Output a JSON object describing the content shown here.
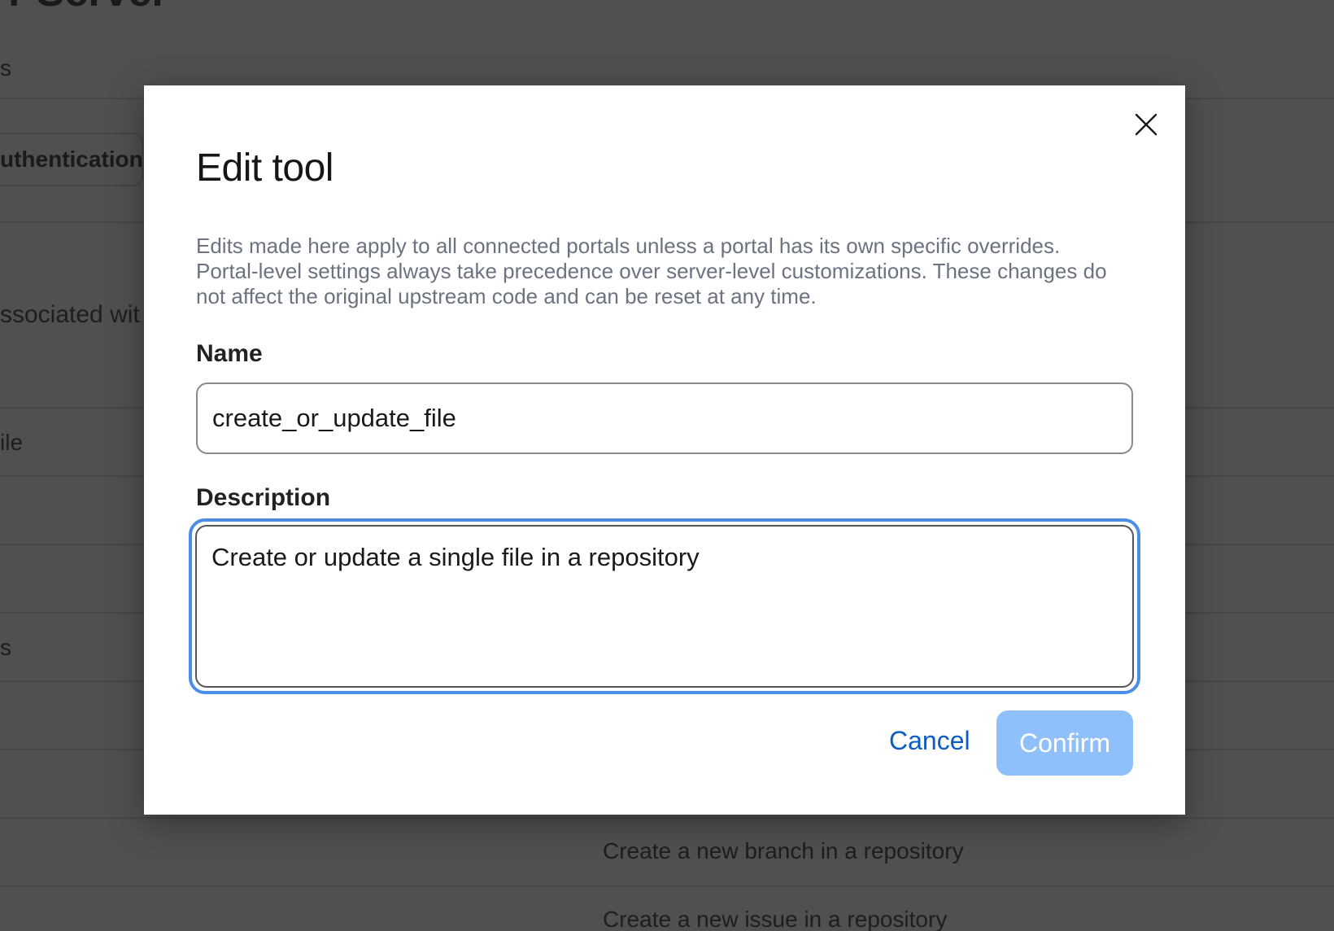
{
  "background": {
    "page_title_fragment": "r Server",
    "tab_fragment": "s",
    "auth_tab_label": "uthentication",
    "section_heading_fragment": "ssociated wit",
    "row_fragments": [
      "ile",
      "s"
    ],
    "tool_descriptions": [
      "Create a new branch in a repository",
      "Create a new issue in a repository"
    ]
  },
  "modal": {
    "title": "Edit tool",
    "close_icon": "close-icon",
    "description": "Edits made here apply to all connected portals unless a portal has its own specific overrides. Portal-level settings always take precedence over server-level customizations. These changes do not affect the original upstream code and can be reset at any time.",
    "name_label": "Name",
    "name_value": "create_or_update_file",
    "description_label": "Description",
    "description_value": "Create or update a single file in a repository",
    "cancel_label": "Cancel",
    "confirm_label": "Confirm"
  },
  "colors": {
    "overlay": "#505050",
    "focus_ring": "#4a8ee8",
    "link": "#0b5cc5",
    "confirm_disabled": "#8fc0fb"
  }
}
